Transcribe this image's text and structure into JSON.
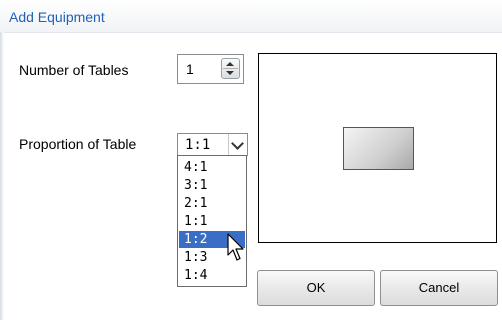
{
  "window": {
    "title": "Add Equipment"
  },
  "form": {
    "number_of_tables_label": "Number of Tables",
    "number_of_tables_value": "1",
    "proportion_label": "Proportion of Table",
    "proportion_value": "1:1"
  },
  "dropdown": {
    "options": [
      "4:1",
      "3:1",
      "2:1",
      "1:1",
      "1:2",
      "1:3",
      "1:4"
    ],
    "highlighted": "1:2"
  },
  "buttons": {
    "ok": "OK",
    "cancel": "Cancel"
  },
  "colors": {
    "title": "#2161b8",
    "selection": "#3a6ec6"
  }
}
